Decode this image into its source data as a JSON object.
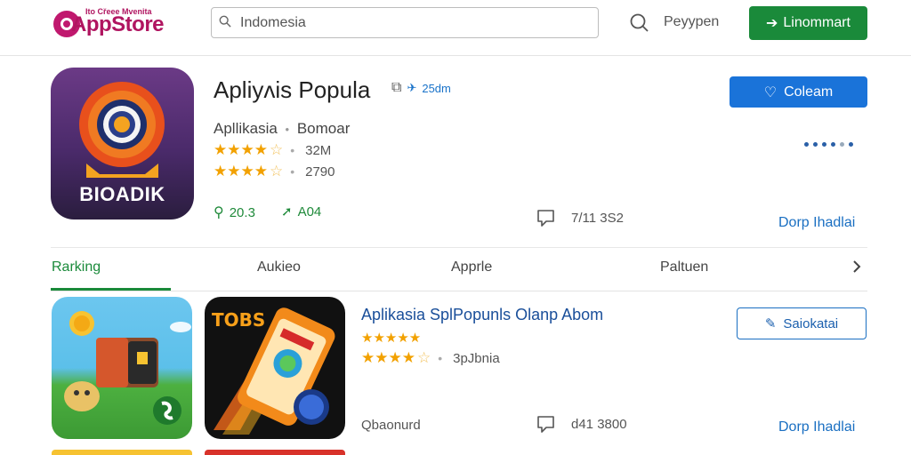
{
  "header": {
    "logo_small": "Ito Cřeee Mvenita",
    "logo_main": "AppStore",
    "search_placeholder": "Indomesia",
    "user_label": "Peyypen",
    "primary_button": "Linommart"
  },
  "featured": {
    "icon_text": "BIOADIK",
    "title": "Apliyʌis Popula",
    "title_meta": "25dm",
    "subtitle_category": "Apllikasia",
    "subtitle_sep": "•",
    "subtitle_dev": "Bomoar",
    "rating1": {
      "stars": 4.5,
      "count": "32M"
    },
    "rating2": {
      "stars": 4.5,
      "count": "2790"
    },
    "stat_installs": "20.3",
    "stat_trend": "A04",
    "size": "7/11 3S2",
    "primary_button": "Coleam",
    "link": "Dorp Ihadlai"
  },
  "tabs": [
    {
      "label": "Rarking",
      "active": true
    },
    {
      "label": "Aukieo",
      "active": false
    },
    {
      "label": "Apprle",
      "active": false
    },
    {
      "label": "Paltuen",
      "active": false
    }
  ],
  "list": [
    {
      "icon2_text": "TOBS",
      "title": "Aplikasia SplPopunls Olanp Abom",
      "rating1": {
        "stars": 5
      },
      "rating2": {
        "stars": 4.5,
        "count": "3pJbnia"
      },
      "footer_left": "Qbaonurd",
      "size": "d41 3800",
      "button": "Saiokatai",
      "link": "Dorp Ihadlai"
    }
  ],
  "colors": {
    "brand": "#b01560",
    "accent_green": "#1a8a3a",
    "accent_blue": "#1a73d9",
    "star": "#f2a100"
  }
}
